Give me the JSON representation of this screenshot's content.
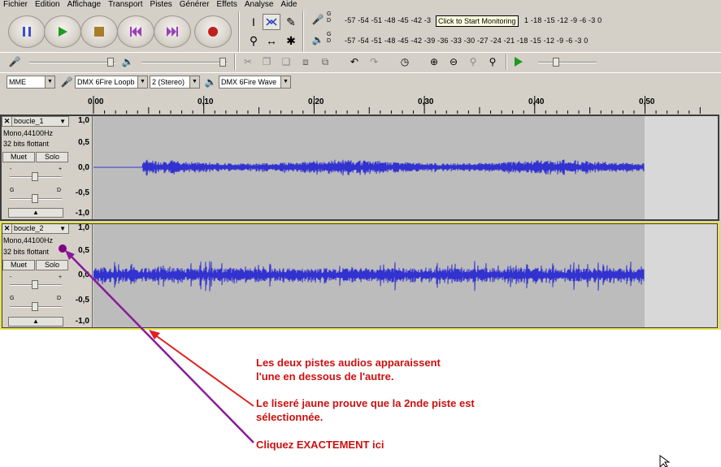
{
  "menu": [
    "Fichier",
    "Edition",
    "Affichage",
    "Transport",
    "Pistes",
    "Générer",
    "Effets",
    "Analyse",
    "Aide"
  ],
  "transport_buttons": [
    {
      "name": "pause-button",
      "icon": "pause-icon",
      "color": "#3b4fc8"
    },
    {
      "name": "play-button",
      "icon": "play-icon",
      "color": "#1f9a1f"
    },
    {
      "name": "stop-button",
      "icon": "stop-icon",
      "color": "#a87e2a"
    },
    {
      "name": "skip-start-button",
      "icon": "skip-start-icon",
      "color": "#9a3fb8"
    },
    {
      "name": "skip-end-button",
      "icon": "skip-end-icon",
      "color": "#9a3fb8"
    },
    {
      "name": "record-button",
      "icon": "record-icon",
      "color": "#c02020"
    }
  ],
  "meters": {
    "record_row": "-57 -54 -51 -48 -45 -42 -3",
    "record_row_tail": "1 -18 -15 -12  -9  -6  -3  0",
    "play_row": "-57 -54 -51 -48 -45 -42 -39 -36 -33 -30 -27 -24 -21 -18 -15 -12  -9  -6  -3  0",
    "channel_left": "G",
    "channel_right": "D",
    "tooltip": "Click to Start Monitoring"
  },
  "devices": {
    "host": "MME",
    "input": "DMX 6Fire Loopb",
    "channels": "2 (Stereo)",
    "output": "DMX 6Fire Wave"
  },
  "ruler": [
    "0,00",
    "0,10",
    "0,20",
    "0,30",
    "0,40",
    "0,50"
  ],
  "tracks": [
    {
      "name": "boucle_1",
      "format": "Mono,44100Hz",
      "bits": "32 bits flottant",
      "mute": "Muet",
      "solo": "Solo",
      "gain_minus": "-",
      "gain_plus": "+",
      "pan_left": "G",
      "pan_right": "D",
      "scale": [
        "1,0",
        "0,5",
        "0,0",
        "-0,5",
        "-1,0"
      ],
      "selected": false
    },
    {
      "name": "boucle_2",
      "format": "Mono,44100Hz",
      "bits": "32 bits flottant",
      "mute": "Muet",
      "solo": "Solo",
      "gain_minus": "-",
      "gain_plus": "+",
      "pan_left": "G",
      "pan_right": "D",
      "scale": [
        "1,0",
        "0,5",
        "0,0",
        "-0,5",
        "-1,0"
      ],
      "selected": true
    }
  ],
  "annotations": {
    "line1a": "Les deux pistes audios apparaissent",
    "line1b": "l'une en dessous de l'autre.",
    "line2a": "Le liseré jaune prouve que la 2nde piste est",
    "line2b": "sélectionnée.",
    "line3": "Cliquez EXACTEMENT ici",
    "colors": {
      "text": "#cc1010",
      "red_arrow": "#e02020",
      "purple_arrow": "#8a1a9a",
      "dot": "#800080"
    }
  },
  "colors": {
    "waveform": "#3232d0",
    "selection_border": "#e6e250",
    "wave_bg": "#bcbcbc"
  }
}
